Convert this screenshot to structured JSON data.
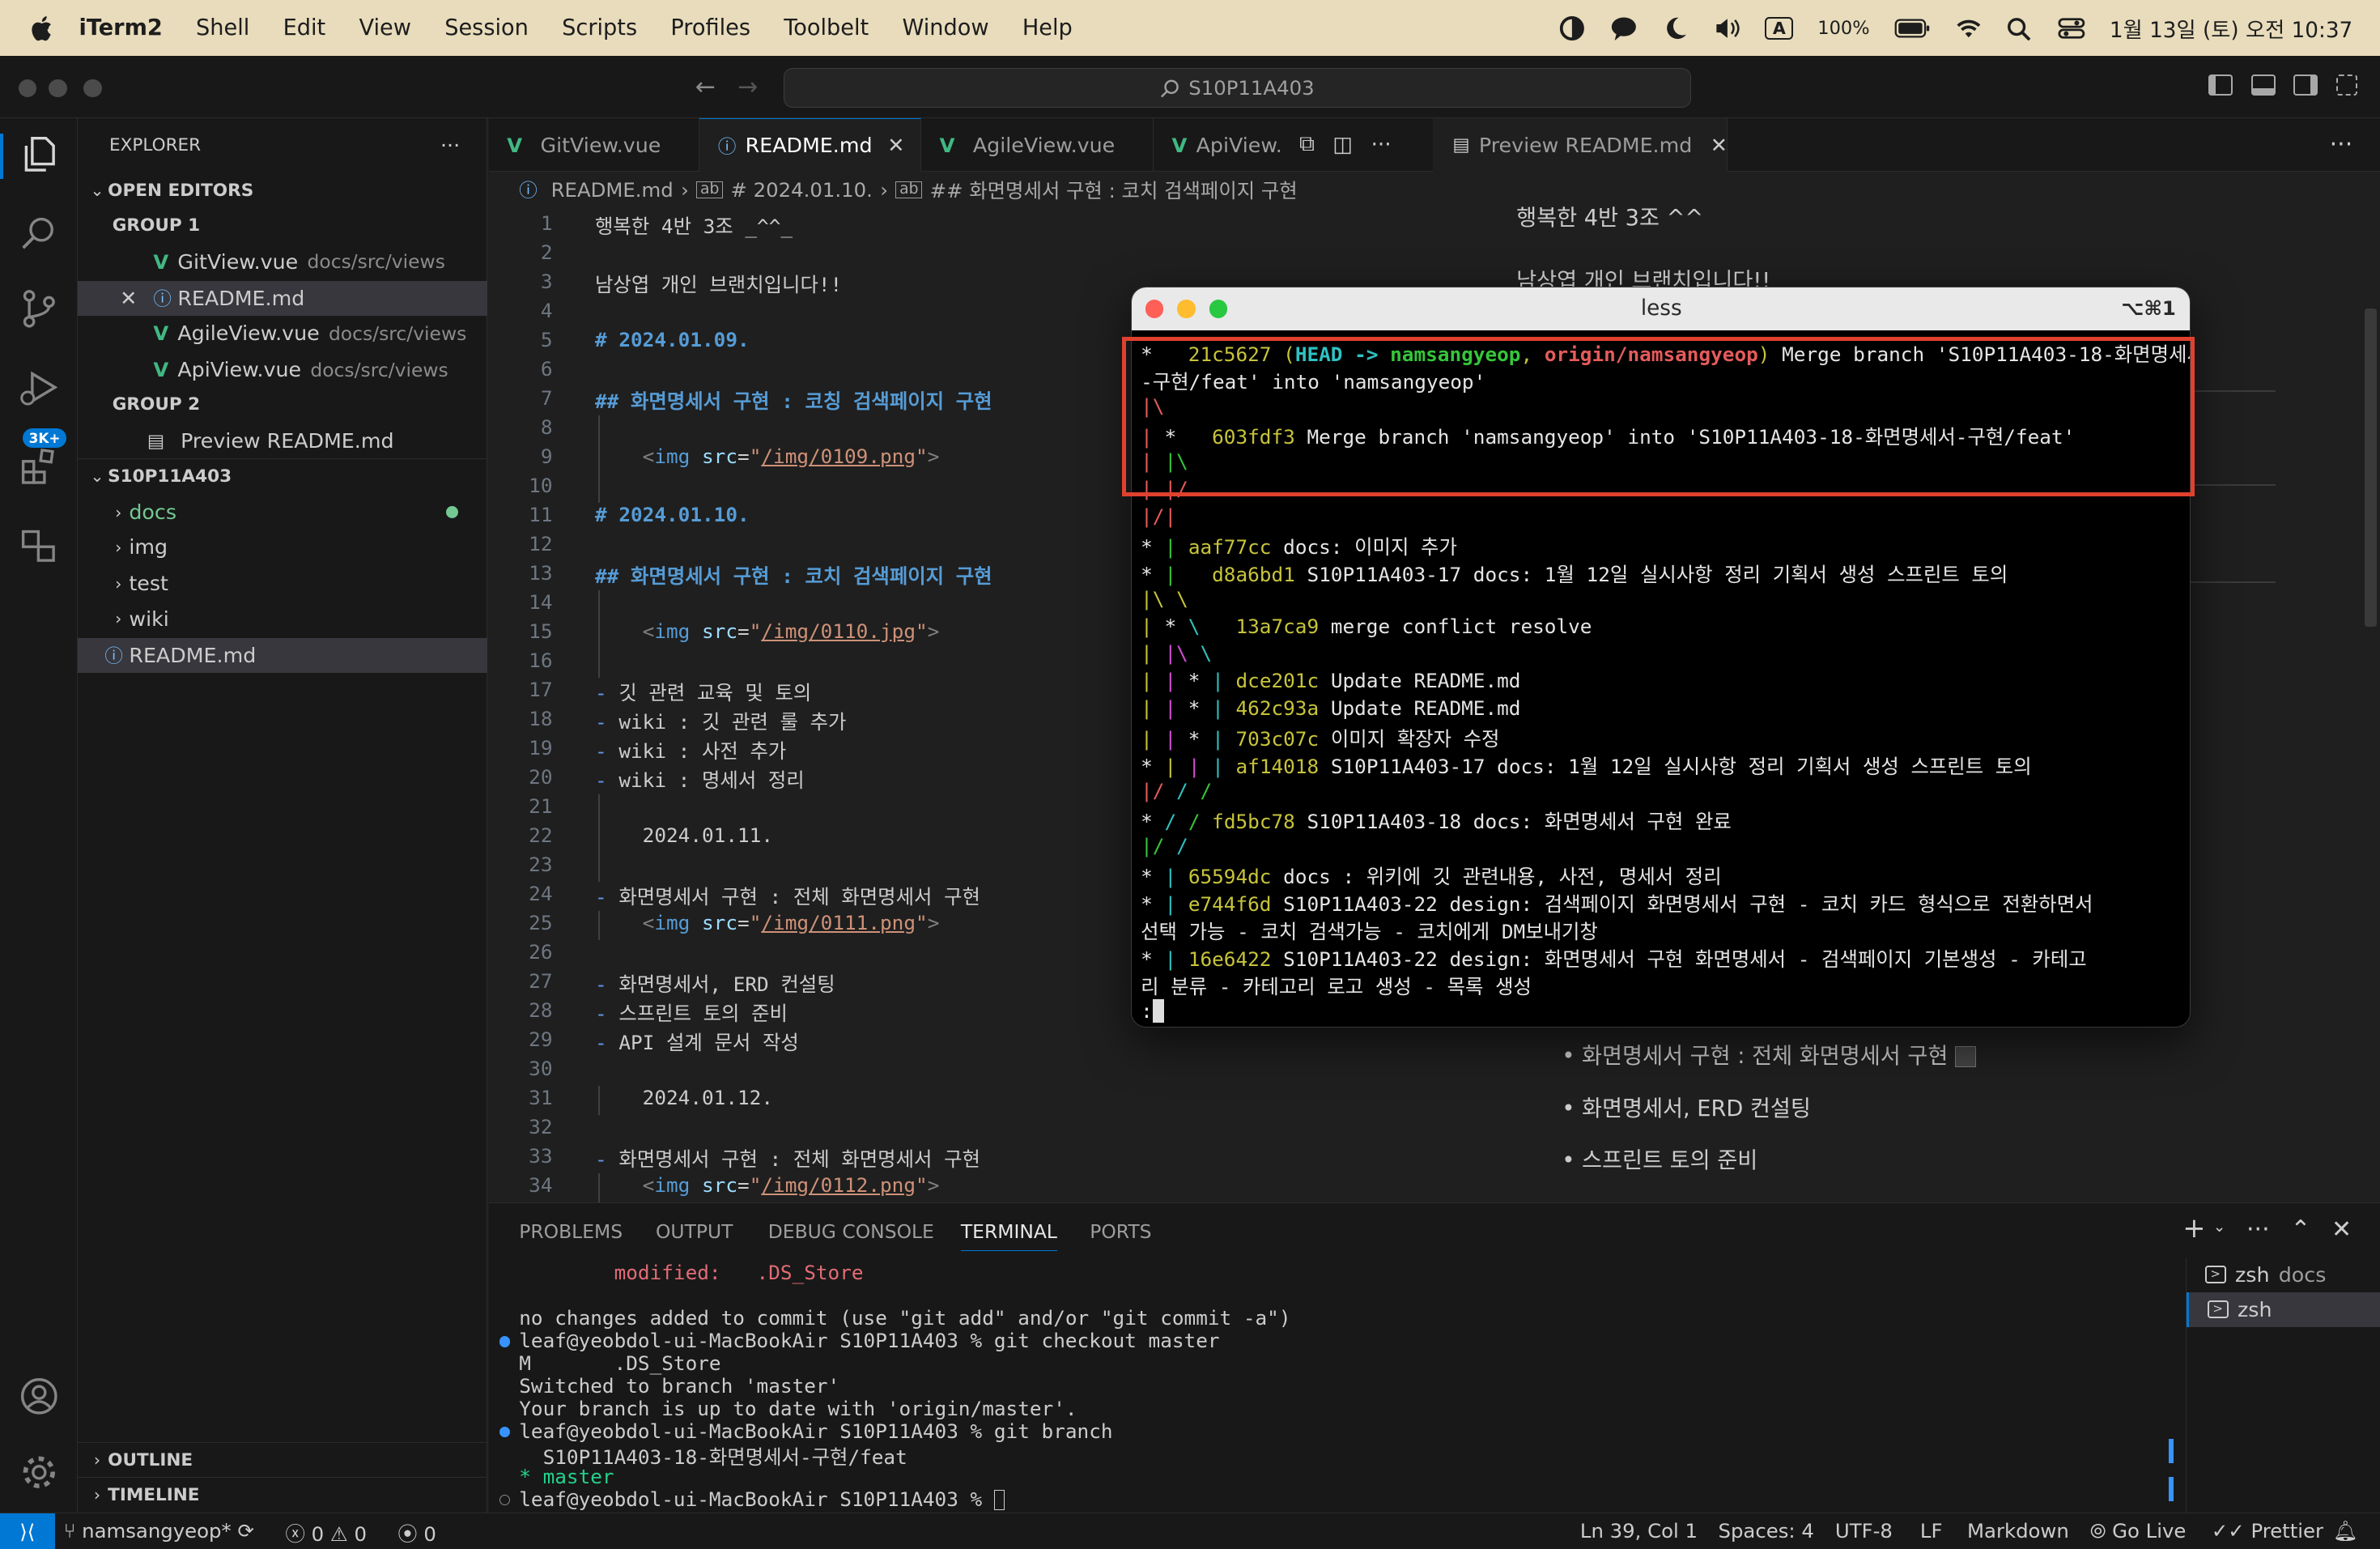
{
  "menubar": {
    "app": "iTerm2",
    "items": [
      "Shell",
      "Edit",
      "View",
      "Session",
      "Scripts",
      "Profiles",
      "Toolbelt",
      "Window",
      "Help"
    ],
    "battery": "100%",
    "datetime": "1월 13일 (토) 오전 10:37",
    "input_indicator": "A"
  },
  "titlebar": {
    "search": "S10P11A403"
  },
  "explorer": {
    "title": "EXPLORER",
    "open_editors": "OPEN EDITORS",
    "group1": "GROUP 1",
    "group2": "GROUP 2",
    "g1": [
      {
        "name": "GitView.vue",
        "desc": "docs/src/views"
      },
      {
        "name": "README.md",
        "desc": ""
      },
      {
        "name": "AgileView.vue",
        "desc": "docs/src/views"
      },
      {
        "name": "ApiView.vue",
        "desc": "docs/src/views"
      }
    ],
    "g2": [
      {
        "name": "Preview README.md"
      }
    ],
    "project": "S10P11A403",
    "folders": [
      "docs",
      "img",
      "test",
      "wiki"
    ],
    "file": "README.md",
    "outline": "OUTLINE",
    "timeline": "TIMELINE",
    "badge": "3K+"
  },
  "tabs": [
    "GitView.vue",
    "README.md",
    "AgileView.vue",
    "ApiView."
  ],
  "preview_tab": "Preview README.md",
  "breadcrumbs": [
    "README.md",
    "# 2024.01.10.",
    "## 화면명세서 구현 : 코치 검색페이지 구현"
  ],
  "code_lines": [
    "행복한 4반 3조 _^^_",
    "",
    "남상엽 개인 브랜치입니다!!",
    "",
    "# 2024.01.09.",
    "",
    "## 화면명세서 구현 : 코칭 검색페이지 구현",
    "",
    "    <img src=\"/img/0109.png\">",
    "",
    "# 2024.01.10.",
    "",
    "## 화면명세서 구현 : 코치 검색페이지 구현",
    "",
    "    <img src=\"/img/0110.jpg\">",
    "",
    "- 깃 관련 교육 및 토의",
    "- wiki : 깃 관련 룰 추가",
    "- wiki : 사전 추가",
    "- wiki : 명세서 정리",
    "",
    "    2024.01.11.",
    "",
    "- 화면명세서 구현 : 전체 화면명세서 구현",
    "    <img src=\"/img/0111.png\">",
    "",
    "- 화면명세서, ERD 컨설팅",
    "- 스프린트 토의 준비",
    "- API 설계 문서 작성",
    "",
    "    2024.01.12.",
    "",
    "- 화면명세서 구현 : 전체 화면명세서 구현",
    "    <img src=\"/img/0112.png\">"
  ],
  "preview": {
    "line1": "행복한 4반 3조 ^^",
    "line2": "남상엽 개인 브랜치입니다!!",
    "bullets": [
      "화면명세서 구현 : 전체 화면명세서 구현",
      "화면명세서, ERD 컨설팅",
      "스프린트 토의 준비"
    ]
  },
  "less": {
    "title": "less",
    "shortcut": "⌥⌘1"
  },
  "git_log": [
    {
      "hash": "21c5627",
      "msg": "Merge branch 'S10P11A403-18-화면명세서"
    },
    {
      "cont": "-구현/feat' into 'namsangyeop'"
    },
    {
      "hash": "603fdf3",
      "msg": "Merge branch 'namsangyeop' into 'S10P11A403-18-화면명세서-구현/feat'"
    },
    {
      "hash": "aaf77cc",
      "msg": "docs: 이미지 추가"
    },
    {
      "hash": "d8a6bd1",
      "msg": "S10P11A403-17 docs: 1월 12일 실시사항 정리 기획서 생성 스프린트 토의"
    },
    {
      "hash": "13a7ca9",
      "msg": "merge conflict resolve"
    },
    {
      "hash": "dce201c",
      "msg": "Update README.md"
    },
    {
      "hash": "462c93a",
      "msg": "Update README.md"
    },
    {
      "hash": "703c07c",
      "msg": "이미지 확장자 수정"
    },
    {
      "hash": "af14018",
      "msg": "S10P11A403-17 docs: 1월 12일 실시사항 정리 기획서 생성 스프린트 토의"
    },
    {
      "hash": "fd5bc78",
      "msg": "S10P11A403-18 docs: 화면명세서 구현 완료"
    },
    {
      "hash": "65594dc",
      "msg": "docs : 위키에 깃 관련내용, 사전, 명세서 정리"
    },
    {
      "hash": "e744f6d",
      "msg": "S10P11A403-22 design: 검색페이지 화면명세서 구현 - 코치 카드 형식으로 전환하면서"
    },
    {
      "cont": "선택 가능 - 코치 검색가능 - 코치에게 DM보내기창"
    },
    {
      "hash": "16e6422",
      "msg": "S10P11A403-22 design: 화면명세서 구현 화면명세서 - 검색페이지 기본생성 - 카테고"
    },
    {
      "cont": "리 분류 - 카테고리 로고 생성 - 목록 생성"
    }
  ],
  "git_refs": {
    "head": "HEAD -> ",
    "branch": "namsangyeop",
    "origin": "origin/namsangyeop"
  },
  "panel": {
    "tabs": [
      "PROBLEMS",
      "OUTPUT",
      "DEBUG CONSOLE",
      "TERMINAL",
      "PORTS"
    ],
    "terminal": [
      "        modified:   .DS_Store",
      "",
      "no changes added to commit (use \"git add\" and/or \"git commit -a\")",
      "leaf@yeobdol-ui-MacBookAir S10P11A403 % git checkout master",
      "M       .DS_Store",
      "Switched to branch 'master'",
      "Your branch is up to date with 'origin/master'.",
      "leaf@yeobdol-ui-MacBookAir S10P11A403 % git branch",
      "  S10P11A403-18-화면명세서-구현/feat",
      "* master",
      "leaf@yeobdol-ui-MacBookAir S10P11A403 % "
    ],
    "terminals": [
      {
        "name": "zsh",
        "desc": "docs"
      },
      {
        "name": "zsh",
        "desc": ""
      }
    ]
  },
  "status": {
    "branch": "namsangyeop*",
    "errors": "0",
    "warnings": "0",
    "ports": "0",
    "position": "Ln 39, Col 1",
    "spaces": "Spaces: 4",
    "encoding": "UTF-8",
    "eol": "LF",
    "language": "Markdown",
    "golive": "Go Live",
    "prettier": "Prettier"
  }
}
